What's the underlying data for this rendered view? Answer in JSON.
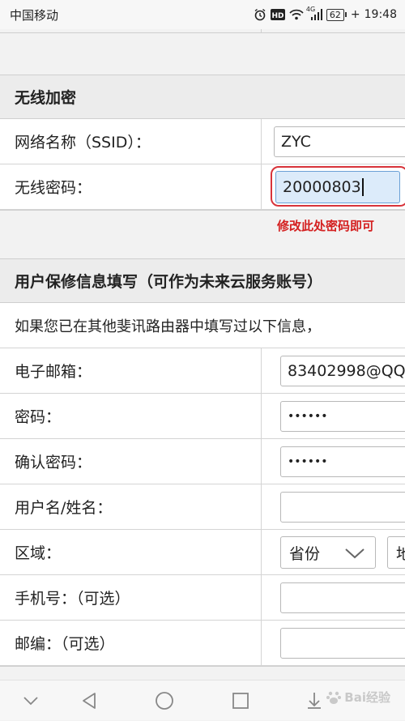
{
  "status_bar": {
    "carrier": "中国移动",
    "network": "4G",
    "battery": "62",
    "time": "19:48",
    "icons": [
      "alarm-icon",
      "hd-icon",
      "wifi-icon",
      "signal-icon",
      "battery-icon"
    ]
  },
  "wireless_section": {
    "title": "无线加密",
    "ssid_label": "网络名称（SSID）：",
    "ssid_value": "ZYC",
    "password_label": "无线密码：",
    "password_value": "20000803",
    "annotation": "修改此处密码即可",
    "highlight_color": "#d8333a"
  },
  "user_section": {
    "title": "用户保修信息填写（可作为未来云服务账号）",
    "info_text": "如果您已在其他斐讯路由器中填写过以下信息，",
    "email_label": "电子邮箱：",
    "email_value": "83402998@QQ",
    "password_label": "密码：",
    "password_value": "••••••",
    "confirm_label": "确认密码：",
    "confirm_value": "••••••",
    "username_label": "用户名/姓名：",
    "username_value": "",
    "region_label": "区域：",
    "province_select": "省份",
    "city_select": "地",
    "phone_label": "手机号：（可选）",
    "phone_value": "",
    "postcode_label": "邮编：（可选）",
    "postcode_value": ""
  },
  "nav_bar": {
    "buttons": [
      "chevron-down-icon",
      "back-icon",
      "home-icon",
      "recents-icon",
      "download-icon"
    ]
  },
  "watermark": {
    "text": "Bai经验"
  }
}
